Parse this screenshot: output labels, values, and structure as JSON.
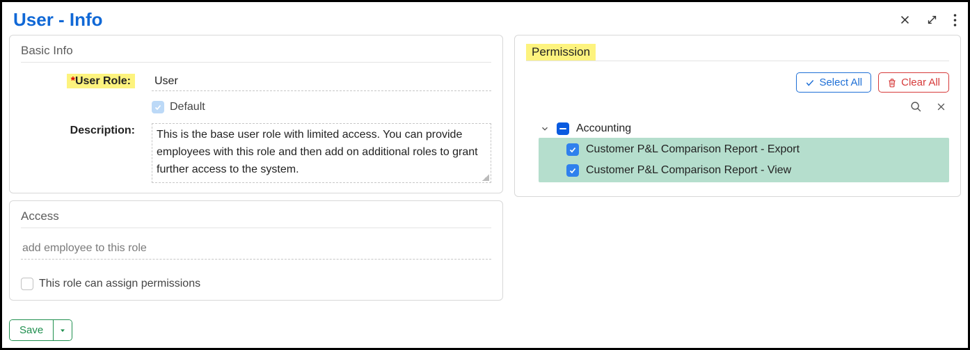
{
  "header": {
    "title": "User - Info"
  },
  "basic_info": {
    "section_title": "Basic Info",
    "user_role_label": "User Role:",
    "user_role_value": "User",
    "default_label": "Default",
    "description_label": "Description:",
    "description_value": "This is the base user role with limited access.  You can provide employees with this role and then add on additional roles to grant further access to the system."
  },
  "access": {
    "section_title": "Access",
    "add_employee_placeholder": "add employee to this role",
    "assign_permissions_label": "This role can assign permissions"
  },
  "permission": {
    "section_title": "Permission",
    "select_all_label": "Select All",
    "clear_all_label": "Clear All",
    "tree": {
      "root_label": "Accounting",
      "children": [
        {
          "label": "Customer P&L Comparison Report - Export"
        },
        {
          "label": "Customer P&L Comparison Report - View"
        }
      ]
    }
  },
  "footer": {
    "save_label": "Save"
  }
}
